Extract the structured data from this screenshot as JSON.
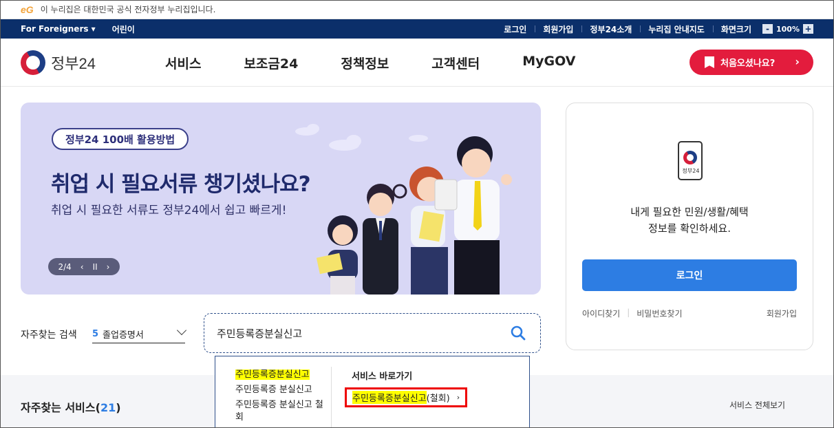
{
  "notice": {
    "logo": "eG",
    "text": "이 누리집은 대한민국 공식 전자정부 누리집입니다."
  },
  "utilbar": {
    "left": [
      "For Foreigners ▾",
      "어린이"
    ],
    "right": [
      "로그인",
      "회원가입",
      "정부24소개",
      "누리집 안내지도",
      "화면크기"
    ],
    "zoom_minus": "-",
    "zoom_value": "100%",
    "zoom_plus": "+"
  },
  "header": {
    "logo_text": "정부24",
    "menu": [
      "서비스",
      "보조금24",
      "정책정보",
      "고객센터",
      "MyGOV"
    ],
    "first_visit": "처음오셨나요?",
    "first_visit_arrow": "›"
  },
  "banner": {
    "pill": "정부24 100배 활용방법",
    "headline": "취업 시 필요서류 챙기셨나요?",
    "sub": "취업 시 필요한 서류도 정부24에서 쉽고 빠르게!",
    "pager": {
      "counter": "2/4",
      "prev": "‹",
      "pause": "II",
      "next": "›"
    }
  },
  "login": {
    "phone_text": "정부24",
    "msg_line1": "내게 필요한 민원/생활/혜택",
    "msg_line2": "정보를 확인하세요.",
    "button": "로그인",
    "find_id": "아이디찾기",
    "find_pw": "비밀번호찾기",
    "join": "회원가입"
  },
  "freq": {
    "label": "자주찾는 검색",
    "num": "5",
    "value": "졸업증명서"
  },
  "search": {
    "value": "주민등록증분실신고"
  },
  "autocomplete": {
    "suggestions": [
      "주민등록증분실신고",
      "주민등록증 분실신고",
      "주민등록증 분실신고 철회"
    ],
    "shortcut_header": "서비스 바로가기",
    "shortcut_highlight": "주민등록증분실신고",
    "shortcut_rest": "(철회)",
    "shortcut_arrow": "›"
  },
  "band": {
    "title_prefix": "자주찾는 서비스(",
    "count": "21",
    "title_suffix": ")",
    "view_all": "서비스 전체보기"
  }
}
